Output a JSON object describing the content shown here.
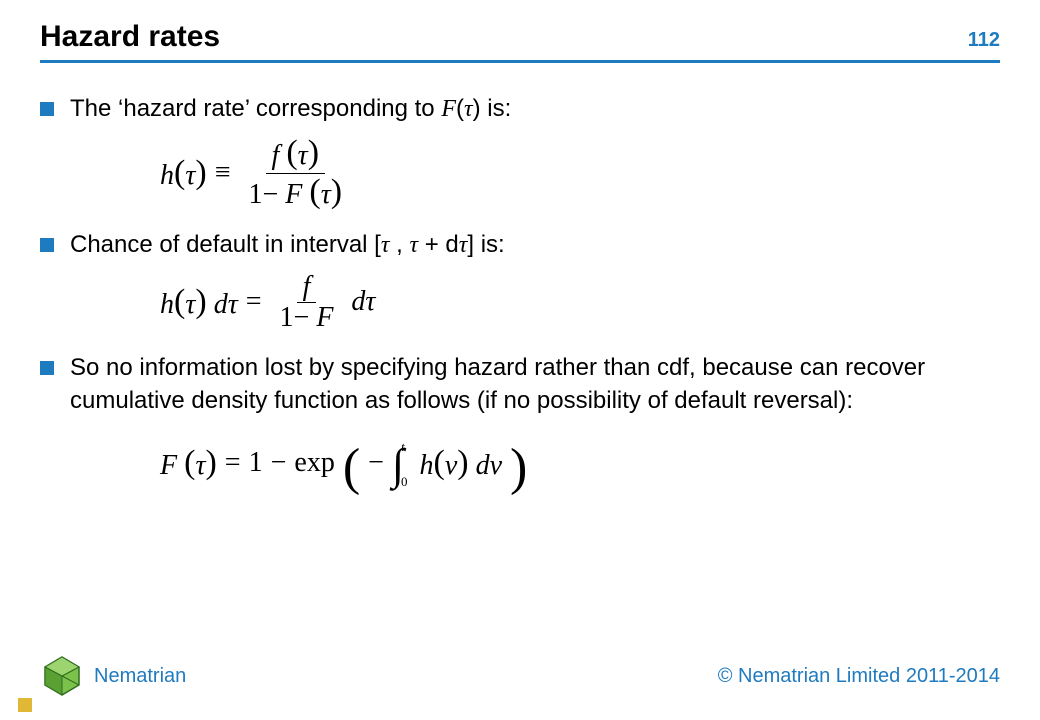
{
  "accent_color": "#1f7bbf",
  "page_number": "112",
  "title": "Hazard rates",
  "bullets": {
    "b1_pre": "The ‘hazard rate’ corresponding to ",
    "b1_F": "F",
    "b1_open": "(",
    "b1_tau": "τ",
    "b1_close": ")",
    "b1_post": " is:",
    "b2_pre": "Chance of default in interval [",
    "b2_tau1": "τ",
    "b2_comma": " , ",
    "b2_tau2": "τ",
    "b2_plus": " + d",
    "b2_tau3": "τ",
    "b2_post": "] is:",
    "b3": "So no information lost by specifying hazard rather than cdf, because can recover cumulative density function as follows (if no possibility of default reversal):"
  },
  "formulas": {
    "f1": {
      "h": "h",
      "lpar": "(",
      "tau": "τ",
      "rpar": ")",
      "equiv": "≡",
      "num_f": "f",
      "num_lpar": "(",
      "num_tau": "τ",
      "num_rpar": ")",
      "den_one": "1",
      "den_minus": "−",
      "den_F": "F",
      "den_lpar": "(",
      "den_tau": "τ",
      "den_rpar": ")"
    },
    "f2": {
      "h": "h",
      "lpar": "(",
      "tau": "τ",
      "rpar": ")",
      "d": "d",
      "tau2": "τ",
      "eq": "=",
      "num_f": "f",
      "den_one": "1",
      "den_minus": "−",
      "den_F": "F",
      "d2": "d",
      "tau3": "τ"
    },
    "f3": {
      "F": "F",
      "lpar": "(",
      "tau": "τ",
      "rpar": ")",
      "eq": "=",
      "one": "1",
      "minus": "−",
      "exp": "exp",
      "blpar": "(",
      "neg": "−",
      "int": "∫",
      "lower": "0",
      "upper": "t",
      "h": "h",
      "hlpar": "(",
      "nu": "ν",
      "hrpar": ")",
      "d": "d",
      "nu2": "ν",
      "brpar": ")"
    }
  },
  "footer": {
    "brand": "Nematrian",
    "copyright": "© Nematrian Limited 2011-2014"
  }
}
